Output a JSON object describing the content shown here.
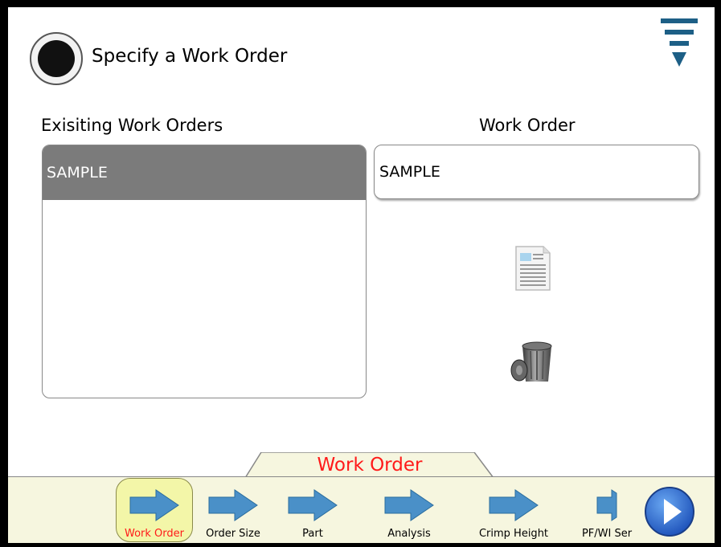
{
  "header": {
    "title": "Specify a Work Order"
  },
  "left": {
    "label": "Exisiting Work Orders",
    "items": [
      "SAMPLE"
    ]
  },
  "right": {
    "label": "Work Order",
    "input_value": "SAMPLE"
  },
  "icons": {
    "record": "record-icon",
    "menu": "menu-icon",
    "document": "document-icon",
    "trash": "trash-icon",
    "next": "next-arrow-icon"
  },
  "nav": {
    "current_tab": "Work Order",
    "steps": [
      "Work Order",
      "Order Size",
      "Part",
      "Analysis",
      "Crimp Height",
      "PF/WI Ser"
    ],
    "active_index": 0
  },
  "colors": {
    "accent": "#ff1a1a",
    "arrow": "#4a90c8",
    "nav_bg": "#f6f6df",
    "selected_row": "#7b7b7b"
  }
}
